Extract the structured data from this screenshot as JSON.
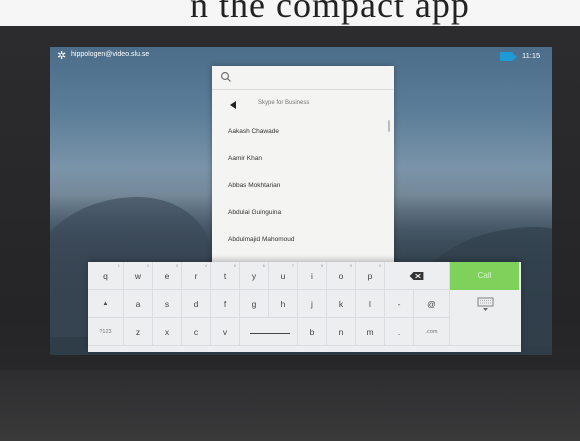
{
  "header_bleed": "n the compact app",
  "status_bar": {
    "account": "hippologen@video.slu.se",
    "time": "11:15"
  },
  "search": {
    "placeholder": "",
    "value": ""
  },
  "source": {
    "label": "Skype for Business"
  },
  "contacts": [
    "Aakash Chawade",
    "Aamir Khan",
    "Abbas Mokhtarian",
    "Abdulai Guinguina",
    "Abdulmajid Mahomoud"
  ],
  "keyboard": {
    "row1": [
      "q",
      "w",
      "e",
      "r",
      "t",
      "y",
      "u",
      "i",
      "o",
      "p"
    ],
    "row1_subs": [
      "1",
      "2",
      "3",
      "4",
      "5",
      "6",
      "7",
      "8",
      "9",
      "0"
    ],
    "row2": [
      "▲",
      "a",
      "s",
      "d",
      "f",
      "g",
      "h",
      "j",
      "k",
      "l",
      "-",
      "@"
    ],
    "row3": [
      "?123",
      "z",
      "x",
      "c",
      "v",
      "",
      "b",
      "n",
      "m",
      ".",
      ".com"
    ],
    "call_label": "Call"
  },
  "colors": {
    "accent_green": "#7ed15a",
    "camera_blue": "#1e9ad6"
  }
}
